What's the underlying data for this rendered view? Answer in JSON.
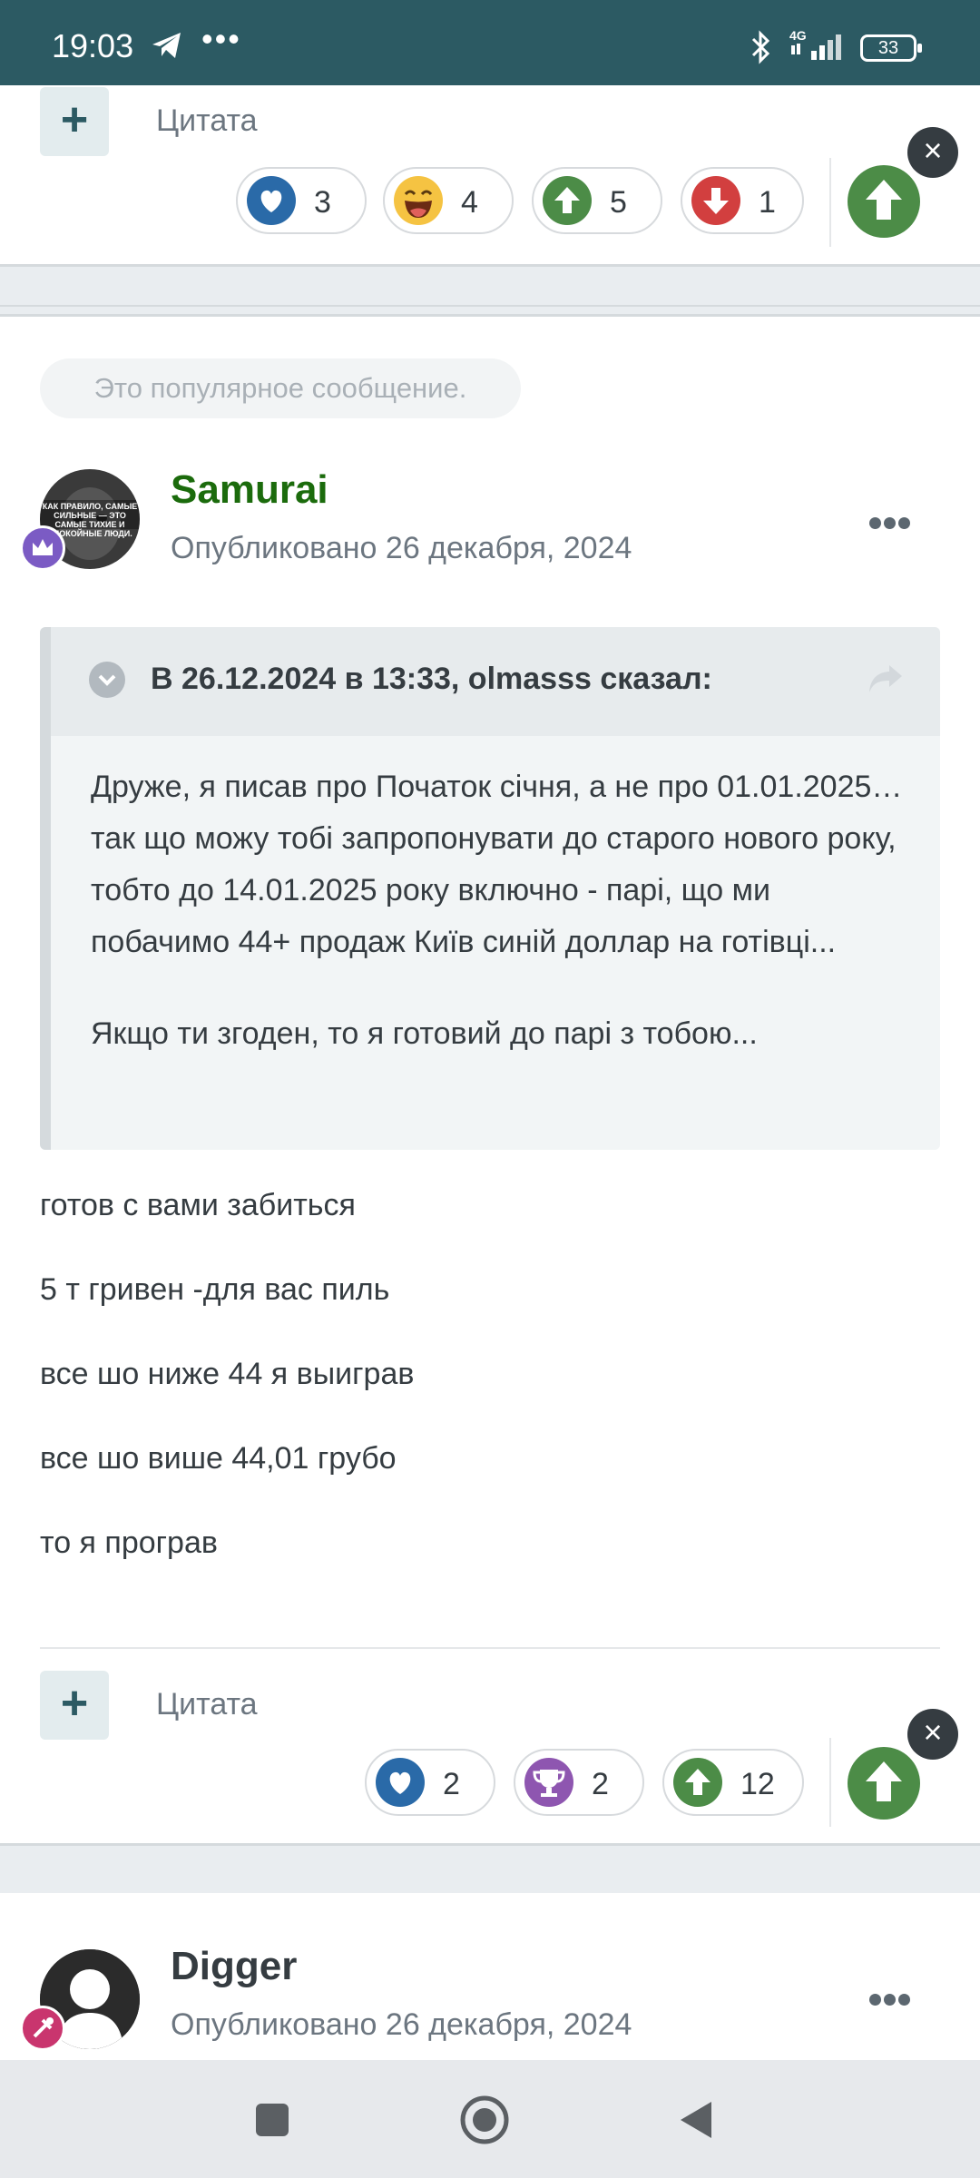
{
  "status_bar": {
    "time": "19:03",
    "extra": "•••",
    "network": "4G",
    "battery": "33"
  },
  "top_post": {
    "quote_label": "Цитата",
    "reactions": [
      {
        "icon": "heart-icon",
        "count": "3"
      },
      {
        "icon": "laugh-icon",
        "count": "4"
      },
      {
        "icon": "upvote-icon",
        "count": "5"
      },
      {
        "icon": "downvote-icon",
        "count": "1"
      }
    ]
  },
  "popular_post": {
    "popular_label": "Это популярное сообщение.",
    "author": "Samurai",
    "published": "Опубликовано 26 декабря, 2024",
    "avatar_text": "КАК ПРАВИЛО, САМЫЕ СИЛЬНЫЕ — ЭТО САМЫЕ ТИХИЕ И СПОКОЙНЫЕ ЛЮДИ.",
    "quote": {
      "citation": "В 26.12.2024 в 13:33, olmasss сказал:",
      "paragraph1": "Друже, я писав про Початок січня, а не про 01.01.2025… так що можу тобі запропонувати до старого нового року, тобто до 14.01.2025 року включно - парі, що ми побачимо 44+ продаж Київ синій доллар на готівці...",
      "paragraph2": "Якщо ти згоден, то я готовий до парі з тобою..."
    },
    "body": [
      "готов с вами забиться",
      "5 т гривен -для вас пиль",
      "все шо ниже 44 я выиграв",
      "все шо више 44,01 грубо",
      "то я програв"
    ],
    "quote_label": "Цитата",
    "reactions": [
      {
        "icon": "heart-icon",
        "count": "2"
      },
      {
        "icon": "trophy-icon",
        "count": "2"
      },
      {
        "icon": "upvote-icon",
        "count": "12"
      }
    ]
  },
  "next_post": {
    "author": "Digger",
    "published": "Опубликовано 26 декабря, 2024"
  },
  "colors": {
    "status_bar": "#2c5a63",
    "author_name": "#1b6b0c",
    "upvote": "#4c8c47",
    "downvote": "#d23f3f",
    "heart": "#2a6aa8",
    "trophy": "#8e56b0"
  }
}
